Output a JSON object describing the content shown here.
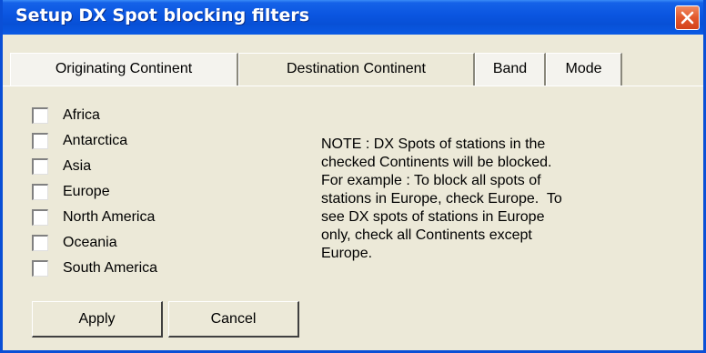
{
  "window": {
    "title": "Setup DX Spot blocking filters"
  },
  "tabs": [
    {
      "label": "Originating Continent",
      "active": false
    },
    {
      "label": "Destination Continent",
      "active": true
    },
    {
      "label": "Band",
      "active": false
    },
    {
      "label": "Mode",
      "active": false
    }
  ],
  "continents": [
    {
      "label": "Africa",
      "checked": false
    },
    {
      "label": "Antarctica",
      "checked": false
    },
    {
      "label": "Asia",
      "checked": false
    },
    {
      "label": "Europe",
      "checked": false
    },
    {
      "label": "North America",
      "checked": false
    },
    {
      "label": "Oceania",
      "checked": false
    },
    {
      "label": "South America",
      "checked": false
    }
  ],
  "note": {
    "lines": [
      "NOTE : DX Spots of stations in the",
      "checked Continents will be blocked.",
      "For example : To block all spots of",
      "stations in Europe, check Europe.  To",
      "see DX spots of stations in Europe",
      "only, check all Continents except",
      "Europe."
    ]
  },
  "buttons": {
    "apply": "Apply",
    "cancel": "Cancel"
  },
  "colors": {
    "titlebar": "#0a55e0",
    "window_bg": "#ece9d8",
    "close_button": "#e2582c"
  },
  "icons": {
    "close": "close-x-icon"
  }
}
